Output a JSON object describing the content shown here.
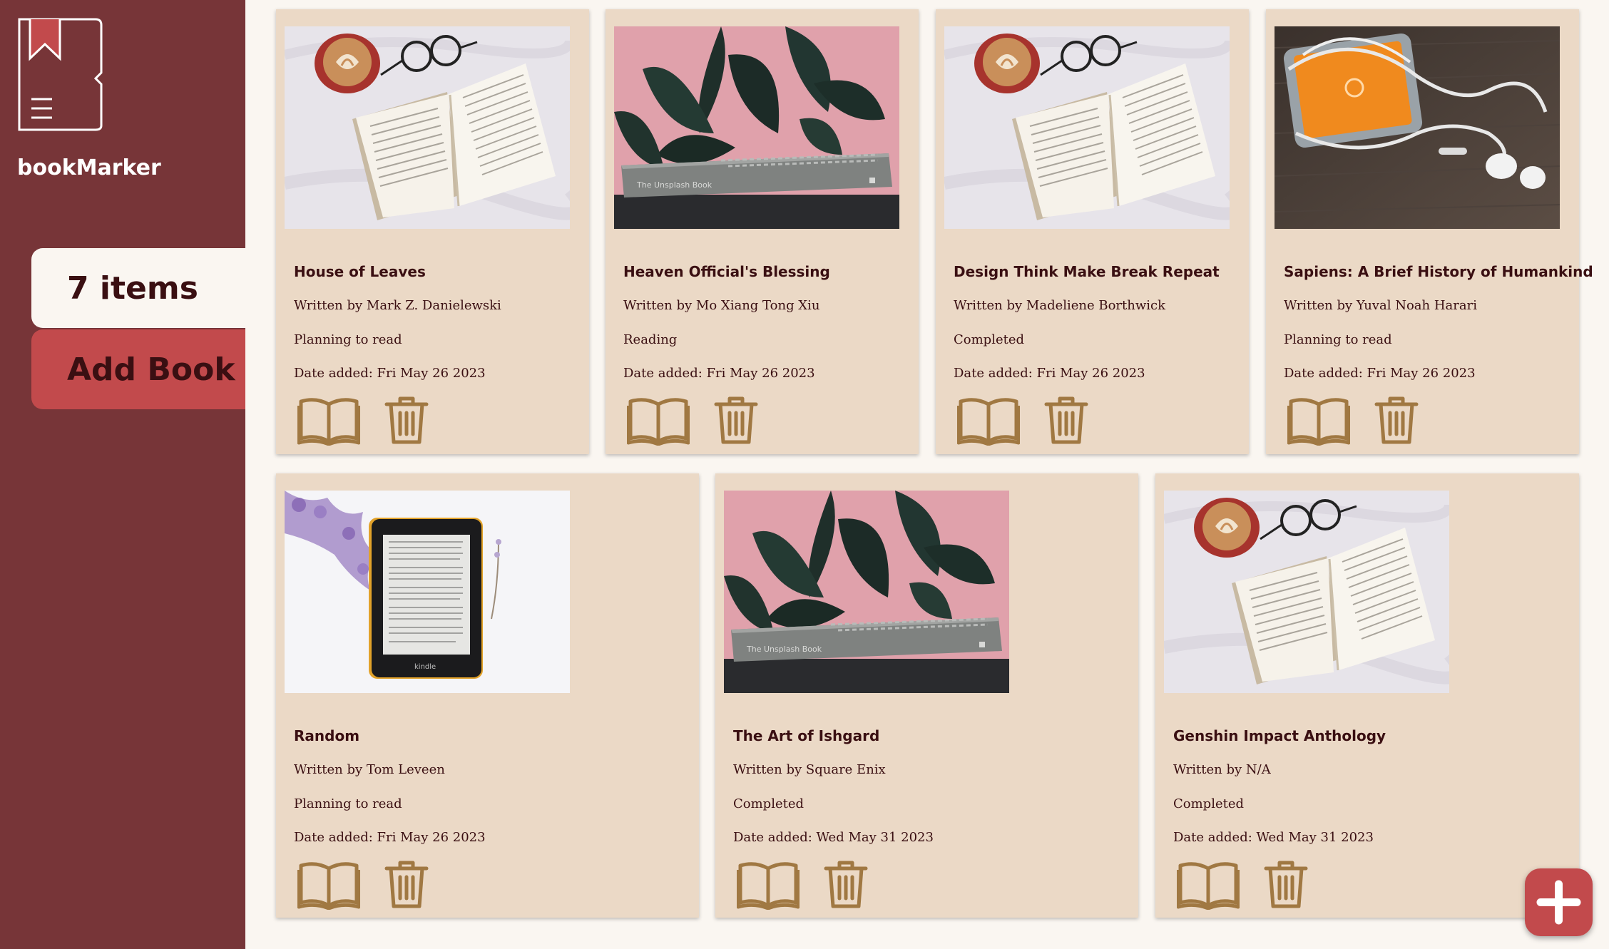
{
  "app": {
    "brand": "bookMarker"
  },
  "sidebar": {
    "items_label": "7 items",
    "add_label": "Add Book"
  },
  "colors": {
    "sidebar": "#773538",
    "accent": "#c24a4c",
    "card": "#ebd9c6",
    "icon": "#a07842",
    "text": "#3a0f12"
  },
  "books": [
    {
      "title": "House of Leaves",
      "author": "Written by Mark Z. Danielewski",
      "status": "Planning to read",
      "date": "Date added: Fri May 26 2023",
      "image": "coffee-book"
    },
    {
      "title": "Heaven Official's Blessing",
      "author": "Written by Mo Xiang Tong Xiu",
      "status": "Reading",
      "date": "Date added: Fri May 26 2023",
      "image": "plant-book"
    },
    {
      "title": "Design Think Make Break Repeat",
      "author": "Written by Madeliene Borthwick",
      "status": "Completed",
      "date": "Date added: Fri May 26 2023",
      "image": "coffee-book"
    },
    {
      "title": "Sapiens: A Brief History of Humankind",
      "author": "Written by Yuval Noah Harari",
      "status": "Planning to read",
      "date": "Date added: Fri May 26 2023",
      "image": "phone-earphones"
    },
    {
      "title": "Random",
      "author": "Written by Tom Leveen",
      "status": "Planning to read",
      "date": "Date added: Fri May 26 2023",
      "image": "kindle"
    },
    {
      "title": "The Art of Ishgard",
      "author": "Written by Square Enix",
      "status": "Completed",
      "date": "Date added: Wed May 31 2023",
      "image": "plant-book"
    },
    {
      "title": "Genshin Impact Anthology",
      "author": "Written by N/A",
      "status": "Completed",
      "date": "Date added: Wed May 31 2023",
      "image": "coffee-book"
    }
  ],
  "image_text": {
    "unsplash_book": "The Unsplash Book",
    "kindle": "kindle"
  },
  "icons": {
    "read": "open-book-icon",
    "delete": "trash-icon",
    "add": "plus-icon",
    "logo": "bookmark-logo-icon"
  }
}
